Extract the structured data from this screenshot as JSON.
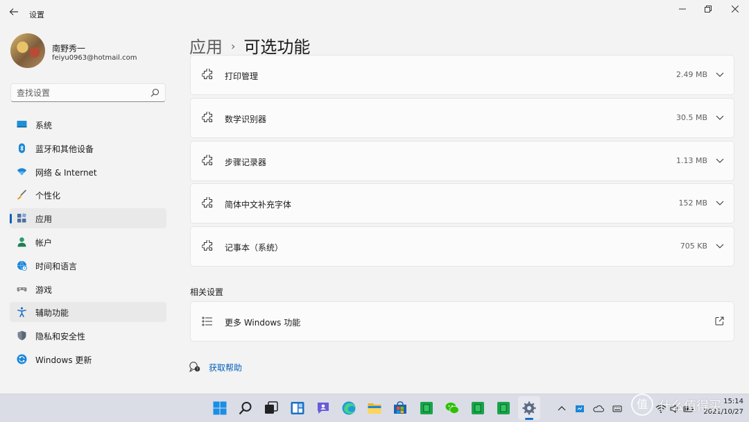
{
  "window": {
    "title": "设置",
    "back_icon": "arrow-left-icon",
    "minimize_icon": "minimize-icon",
    "maximize_icon": "restore-icon",
    "close_icon": "close-icon"
  },
  "profile": {
    "name": "南野秀一",
    "email": "feiyu0963@hotmail.com"
  },
  "search": {
    "placeholder": "查找设置",
    "icon": "search-icon"
  },
  "sidebar": {
    "items": [
      {
        "label": "系统",
        "icon": "monitor-icon",
        "active": false
      },
      {
        "label": "蓝牙和其他设备",
        "icon": "bluetooth-icon",
        "active": false
      },
      {
        "label": "网络 & Internet",
        "icon": "wifi-icon",
        "active": false
      },
      {
        "label": "个性化",
        "icon": "brush-icon",
        "active": false
      },
      {
        "label": "应用",
        "icon": "apps-icon",
        "active": true
      },
      {
        "label": "帐户",
        "icon": "person-icon",
        "active": false
      },
      {
        "label": "时间和语言",
        "icon": "globe-clock-icon",
        "active": false
      },
      {
        "label": "游戏",
        "icon": "gamepad-icon",
        "active": false
      },
      {
        "label": "辅助功能",
        "icon": "accessibility-icon",
        "active": false
      },
      {
        "label": "隐私和安全性",
        "icon": "shield-icon",
        "active": false
      },
      {
        "label": "Windows 更新",
        "icon": "update-icon",
        "active": false
      }
    ]
  },
  "breadcrumb": {
    "parent": "应用",
    "separator": "›",
    "current": "可选功能"
  },
  "features": [
    {
      "name": "打印管理",
      "size": "2.49 MB"
    },
    {
      "name": "数学识别器",
      "size": "30.5 MB"
    },
    {
      "name": "步骤记录器",
      "size": "1.13 MB"
    },
    {
      "name": "简体中文补充字体",
      "size": "152 MB"
    },
    {
      "name": "记事本（系统）",
      "size": "705 KB"
    }
  ],
  "related": {
    "title": "相关设置",
    "more_windows_features": "更多 Windows 功能"
  },
  "help": {
    "label": "获取帮助"
  },
  "taskbar": {
    "apps": [
      "start-icon",
      "search-icon",
      "task-view-icon",
      "widgets-icon",
      "chat-icon",
      "edge-icon",
      "file-explorer-icon",
      "store-icon",
      "green-app-icon",
      "wechat-icon",
      "green-app-icon",
      "green-app-icon",
      "settings-icon"
    ],
    "date": "2021/10/27",
    "time": "15:14"
  },
  "watermark": {
    "logo": "值",
    "text": "什么值得买"
  },
  "colors": {
    "accent": "#005fb8",
    "background": "#f3f3f3",
    "card": "#fbfbfb"
  }
}
